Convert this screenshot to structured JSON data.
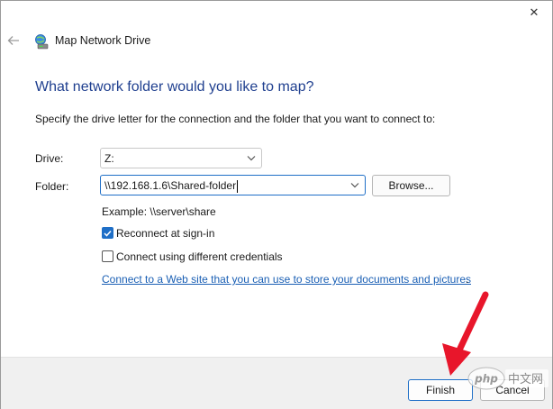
{
  "dialog": {
    "title": "Map Network Drive",
    "close_glyph": "✕"
  },
  "content": {
    "heading": "What network folder would you like to map?",
    "instructions": "Specify the drive letter for the connection and the folder that you want to connect to:",
    "drive_label": "Drive:",
    "drive_value": "Z:",
    "folder_label": "Folder:",
    "folder_value": "\\\\192.168.1.6\\Shared-folder",
    "browse_label": "Browse...",
    "example_text": "Example: \\\\server\\share",
    "reconnect_label": "Reconnect at sign-in",
    "reconnect_checked": true,
    "credentials_label": "Connect using different credentials",
    "credentials_checked": false,
    "web_link": "Connect to a Web site that you can use to store your documents and pictures",
    "web_link_suffix": "."
  },
  "footer": {
    "finish_label": "Finish",
    "cancel_label": "Cancel"
  },
  "watermark": {
    "text": "php 中文网"
  },
  "colors": {
    "accent": "#1f6fc7",
    "heading": "#1f3f8f",
    "link": "#1a5fb4",
    "annotation_arrow": "#e8162b"
  },
  "icons": {
    "back": "back-arrow-icon",
    "app": "network-drive-icon",
    "combo_arrow": "chevron-down-icon",
    "check": "checkmark-icon"
  }
}
